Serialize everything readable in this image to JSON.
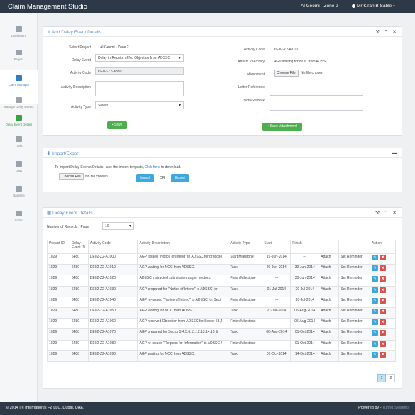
{
  "app": {
    "title": "Claim Management Studio",
    "project": "Al Geemi - Zone 2",
    "user": "Mr Kiran B Sable"
  },
  "sidebar": {
    "items": [
      {
        "label": "Dashboard"
      },
      {
        "label": "Project"
      },
      {
        "label": "Claim Manager"
      },
      {
        "label": "Manage Delay Events"
      },
      {
        "label": "Delay Event Details"
      },
      {
        "label": "Tools"
      },
      {
        "label": "Logs"
      },
      {
        "label": "Baseline"
      },
      {
        "label": "Admin"
      }
    ]
  },
  "add_panel": {
    "title": "Add Delay Event Details",
    "select_project_label": "Select Project",
    "select_project_value": "Al Geemi - Zone 2",
    "delay_event_label": "Delay Event",
    "delay_event_value": "Delay in Receipt of No Objection from ADSSC",
    "activity_code_label": "Activity Code",
    "activity_code_value": "DE02-Z2-A380",
    "activity_description_label": "Activity Description",
    "activity_type_label": "Activity Type",
    "activity_type_value": "Select",
    "save_label": "Save",
    "right_activity_code_label": "Activity Code",
    "right_activity_code_value": "DE02-Z2-A1010",
    "attach_to_activity_label": "Attach To Activity",
    "attach_to_activity_value": "AGP waiting for NOC from ADSSC.",
    "attachment_label": "Attachment",
    "choose_file_label": "Choose File",
    "no_file_label": "No file chosen",
    "letter_reference_label": "Letter Reference",
    "note_remark_label": "Note/Remark",
    "save_attachment_label": "Save Attachment"
  },
  "import_panel": {
    "title": "Import/Export",
    "instructions_prefix": "To Import Delay Events Details - use the import template,",
    "instructions_link": "Click here",
    "instructions_suffix": " to download.",
    "choose_file_label": "Choose File",
    "no_file_label": "No file chosen",
    "import_label": "Import",
    "or_label": "OR",
    "export_label": "Export"
  },
  "details_panel": {
    "title": "Delay Event Details",
    "records_label": "Number of Records / Page",
    "records_value": "10",
    "columns": [
      "Project ID",
      "Delay Event ID",
      "Activity Code",
      "Activity Description",
      "Activity Type",
      "Start",
      "Finish",
      "",
      "",
      "Action"
    ],
    "rows": [
      [
        "1029",
        "6480",
        "DE02-Z2-A1000",
        "AGP issued \"Notice of Intend\" to ADSSC for propose",
        "Start Milestone",
        "19-Jun-2014",
        "---",
        "Attach",
        "Set Reminder"
      ],
      [
        "1029",
        "6480",
        "DE02-Z2-A1010",
        "AGP waiting for NOC from ADSSC.",
        "Task",
        "20-Jun-2014",
        "30-Jun-2014",
        "Attach",
        "Set Reminder"
      ],
      [
        "1029",
        "6480",
        "DE02-Z2-A1020",
        "ADSSC instructed submission as per sectors.",
        "Finish Milestone",
        "---",
        "30-Jun-2014",
        "Attach",
        "Set Reminder"
      ],
      [
        "1029",
        "6480",
        "DE02-Z2-A1030",
        "AGP prepared for \"Notice of Intend\" to ADSSC for",
        "Task",
        "01-Jul-2014",
        "20-Jul-2014",
        "Attach",
        "Set Reminder"
      ],
      [
        "1029",
        "6480",
        "DE02-Z2-A1040",
        "AGP re-issued \"Notice of Intend\" to ADSSC for Sect",
        "Finish Milestone",
        "---",
        "20-Jul-2014",
        "Attach",
        "Set Reminder"
      ],
      [
        "1029",
        "6480",
        "DE02-Z2-A1050",
        "AGP waiting for NOC from ADSSC.",
        "Task",
        "21-Jul-2014",
        "05-Aug-2014",
        "Attach",
        "Set Reminder"
      ],
      [
        "1029",
        "6480",
        "DE02-Z2-A1060",
        "AGP received Objection from ADSSC for Sector 53,4",
        "Finish Milestone",
        "---",
        "05-Aug-2014",
        "Attach",
        "Set Reminder"
      ],
      [
        "1029",
        "6480",
        "DE02-Z2-A1070",
        "AGP prepared for Sector 3,4,5,6,11,12,13,14,15 &",
        "Task",
        "06-Aug-2014",
        "01-Oct-2014",
        "Attach",
        "Set Reminder"
      ],
      [
        "1029",
        "6480",
        "DE02-Z2-A1080",
        "AGP re-issued \"Request for Information\" to ADSSC f",
        "Finish Milestone",
        "---",
        "01-Oct-2014",
        "Attach",
        "Set Reminder"
      ],
      [
        "1029",
        "6480",
        "DE02-Z2-A1090",
        "AGP waiting for NOC from ADSSC.",
        "Task",
        "01-Oct-2014",
        "14-Oct-2014",
        "Attach",
        "Set Reminder"
      ]
    ],
    "pages": [
      "1",
      "2"
    ]
  },
  "footer": {
    "left_prefix": "© 2014 |",
    "left_text": "International FZ LLC, Dubai, UAE.",
    "right_prefix": "Powered by -",
    "right_text": "Turing Systems"
  }
}
